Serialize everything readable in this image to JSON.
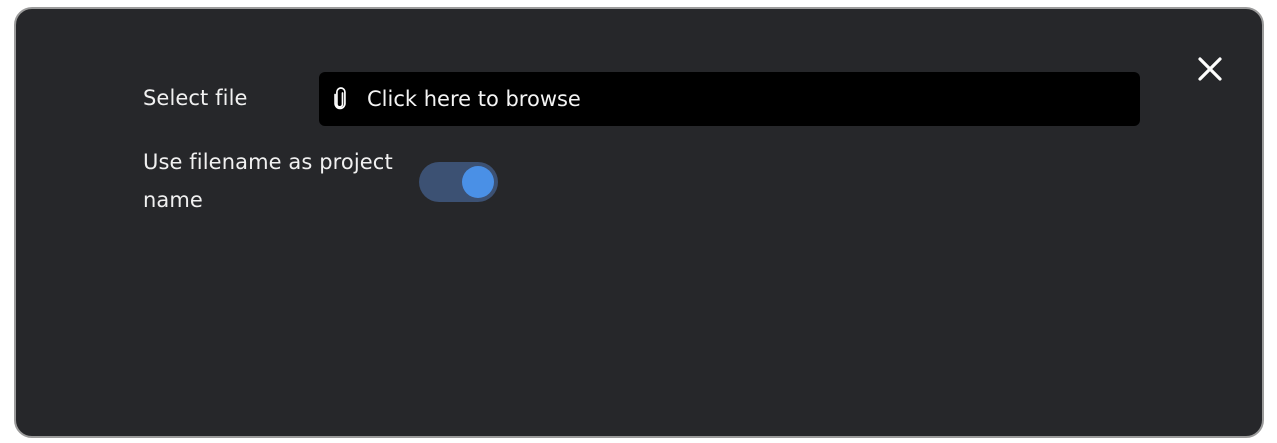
{
  "dialog": {
    "close_icon": "close-icon",
    "select_file": {
      "label": "Select file",
      "placeholder": "Click here to browse",
      "icon": "paperclip-icon"
    },
    "use_filename": {
      "label": "Use filename as project name",
      "enabled": true
    }
  },
  "colors": {
    "dialog_bg": "#26272a",
    "input_bg": "#000000",
    "toggle_track": "#3c5173",
    "toggle_knob": "#4a90e6"
  }
}
